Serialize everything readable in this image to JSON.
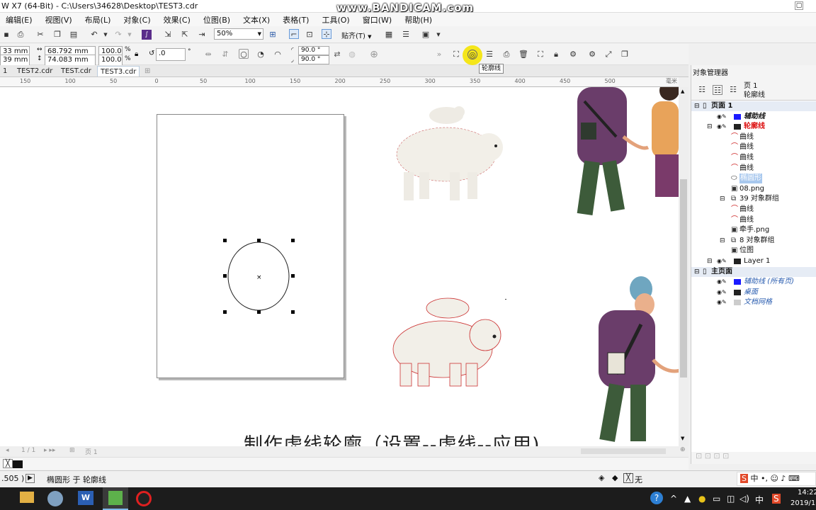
{
  "window": {
    "title": "W X7 (64-Bit) - C:\\Users\\34628\\Desktop\\TEST3.cdr",
    "watermark": "www.BANDICAM.com"
  },
  "menu": [
    "编辑(E)",
    "视图(V)",
    "布局(L)",
    "对象(C)",
    "效果(C)",
    "位图(B)",
    "文本(X)",
    "表格(T)",
    "工具(O)",
    "窗口(W)",
    "帮助(H)"
  ],
  "toolbar": {
    "zoom": "50%",
    "snap_label": "贴齐(T)"
  },
  "properties": {
    "x": "33 mm",
    "y": "39 mm",
    "width": "68.792 mm",
    "height": "74.083 mm",
    "scale_w": "100.0",
    "scale_h": "100.0",
    "pct": "%",
    "rotation": ".0",
    "degree": "°",
    "angle1": "90.0 °",
    "angle2": "90.0 °"
  },
  "tooltip": "轮廓线",
  "tabs": [
    "1",
    "TEST2.cdr",
    "TEST.cdr",
    "TEST3.cdr"
  ],
  "ruler": {
    "ticks": [
      "150",
      "100",
      "50",
      "0",
      "50",
      "100",
      "150",
      "200",
      "250",
      "300",
      "350",
      "400",
      "450",
      "500"
    ],
    "unit": "毫米"
  },
  "docker": {
    "title": "对象管理器",
    "header_page": "页 1",
    "header_layer": "轮廓线",
    "tree": [
      {
        "label": "页面 1",
        "indent": 0,
        "style": "bold",
        "expander": "⊟"
      },
      {
        "label": "辅助线",
        "indent": 1,
        "style": "italic-bold",
        "swatch": "#1a1aff",
        "expander": ""
      },
      {
        "label": "轮廓线",
        "indent": 1,
        "style": "red-bold",
        "swatch": "#222",
        "expander": "⊟"
      },
      {
        "label": "曲线",
        "indent": 2,
        "style": "normal",
        "icon": "curve"
      },
      {
        "label": "曲线",
        "indent": 2,
        "style": "normal",
        "icon": "curve"
      },
      {
        "label": "曲线",
        "indent": 2,
        "style": "normal",
        "icon": "curve"
      },
      {
        "label": "曲线",
        "indent": 2,
        "style": "normal",
        "icon": "curve"
      },
      {
        "label": "椭圆形",
        "indent": 2,
        "style": "selected",
        "icon": "ellipse"
      },
      {
        "label": "08.png",
        "indent": 2,
        "style": "normal",
        "icon": "bitmap"
      },
      {
        "label": "39 对象群组",
        "indent": 2,
        "style": "normal",
        "icon": "group",
        "expander": "⊟"
      },
      {
        "label": "曲线",
        "indent": 2,
        "style": "normal",
        "icon": "curve"
      },
      {
        "label": "曲线",
        "indent": 2,
        "style": "normal",
        "icon": "curve"
      },
      {
        "label": "牵手.png",
        "indent": 2,
        "style": "normal",
        "icon": "bitmap"
      },
      {
        "label": "8 对象群组",
        "indent": 2,
        "style": "normal",
        "icon": "group",
        "expander": "⊟"
      },
      {
        "label": "位图",
        "indent": 2,
        "style": "normal",
        "icon": "bitmap"
      },
      {
        "label": "Layer 1",
        "indent": 1,
        "style": "normal",
        "swatch": "#222",
        "expander": "⊟"
      },
      {
        "label": "主页面",
        "indent": 0,
        "style": "bold",
        "expander": "⊟"
      },
      {
        "label": "辅助线 (所有页)",
        "indent": 1,
        "style": "italic-blue",
        "swatch": "#1a1aff"
      },
      {
        "label": "桌面",
        "indent": 1,
        "style": "italic-blue",
        "swatch": "#222"
      },
      {
        "label": "文档网格",
        "indent": 1,
        "style": "italic-blue",
        "swatch": "#ccc"
      }
    ]
  },
  "page_nav": {
    "counter": "1 / 1",
    "page_tab": "页 1"
  },
  "caption": "制作虚线轮廓（设置--虚线--应用)",
  "status": {
    "coords": ".505 )",
    "selection": "椭圆形 于 轮廓线",
    "fill_none": "无"
  },
  "taskbar": {
    "clock_time": "14:22",
    "clock_date": "2019/1",
    "ime": "中"
  }
}
